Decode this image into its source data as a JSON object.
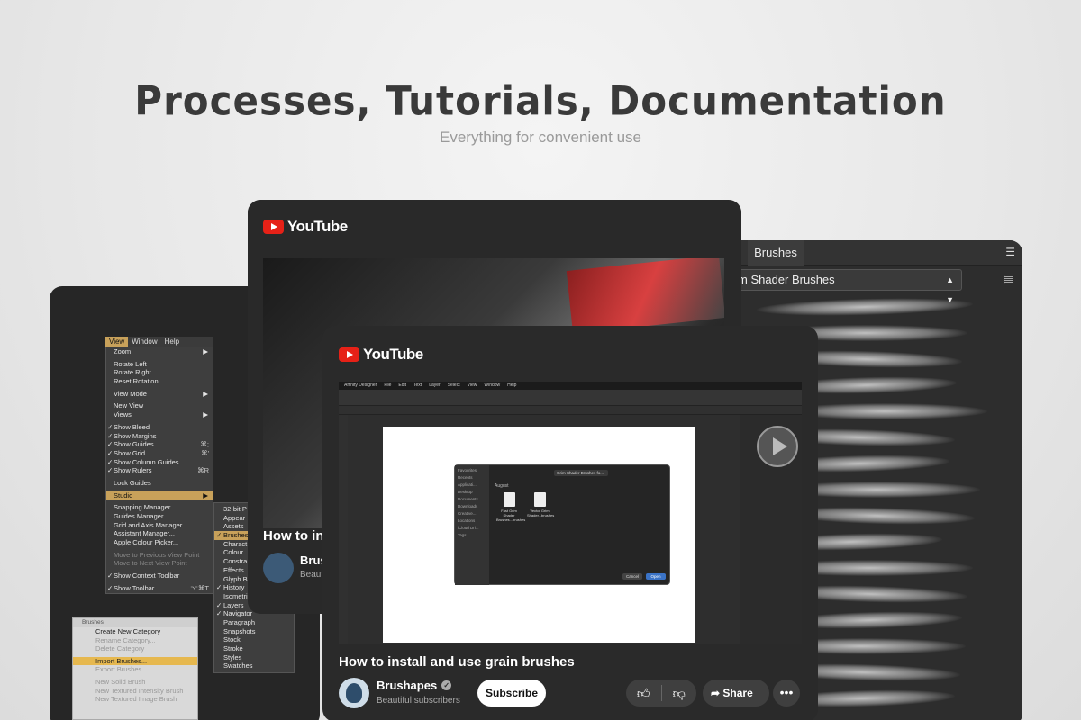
{
  "hero": {
    "title": "Processes, Tutorials, Documentation",
    "subtitle": "Everything for convenient use"
  },
  "left_menu": {
    "menubar": [
      "View",
      "Window",
      "Help"
    ],
    "items": [
      {
        "label": "Zoom",
        "arrow": "▶"
      },
      {
        "label": "Rotate Left",
        "gap": true
      },
      {
        "label": "Rotate Right"
      },
      {
        "label": "Reset Rotation"
      },
      {
        "label": "View Mode",
        "arrow": "▶",
        "gap": true
      },
      {
        "label": "New View",
        "gap": true
      },
      {
        "label": "Views",
        "arrow": "▶"
      },
      {
        "label": "Show Bleed",
        "check": "✓",
        "gap": true
      },
      {
        "label": "Show Margins",
        "check": "✓"
      },
      {
        "label": "Show Guides",
        "check": "✓",
        "shortcut": "⌘;"
      },
      {
        "label": "Show Grid",
        "check": "✓",
        "shortcut": "⌘'"
      },
      {
        "label": "Show Column Guides",
        "check": "✓"
      },
      {
        "label": "Show Rulers",
        "check": "✓",
        "shortcut": "⌘R"
      },
      {
        "label": "Lock Guides",
        "gap": true
      },
      {
        "label": "Studio",
        "arrow": "▶",
        "selected": true,
        "gap": true
      },
      {
        "label": "Snapping Manager...",
        "gap": true
      },
      {
        "label": "Guides Manager..."
      },
      {
        "label": "Grid and Axis Manager..."
      },
      {
        "label": "Assistant Manager..."
      },
      {
        "label": "Apple Colour Picker..."
      },
      {
        "label": "Move to Previous View Point",
        "disabled": true,
        "gap": true
      },
      {
        "label": "Move to Next View Point",
        "disabled": true
      },
      {
        "label": "Show Context Toolbar",
        "check": "✓",
        "gap": true
      },
      {
        "label": "Show Toolbar",
        "check": "✓",
        "shortcut": "⌥⌘T",
        "gap": true
      }
    ],
    "studio_submenu": [
      {
        "label": "32-bit P"
      },
      {
        "label": "Appear"
      },
      {
        "label": "Assets"
      },
      {
        "label": "Brushes",
        "check": "✓",
        "selected": true
      },
      {
        "label": "Charact"
      },
      {
        "label": "Colour"
      },
      {
        "label": "Constra"
      },
      {
        "label": "Effects"
      },
      {
        "label": "Glyph B"
      },
      {
        "label": "History",
        "check": "✓"
      },
      {
        "label": "Isometri"
      },
      {
        "label": "Layers",
        "check": "✓"
      },
      {
        "label": "Navigator",
        "check": "✓"
      },
      {
        "label": "Paragraph"
      },
      {
        "label": "Snapshots"
      },
      {
        "label": "Stock"
      },
      {
        "label": "Stroke"
      },
      {
        "label": "Styles"
      },
      {
        "label": "Swatches"
      }
    ],
    "brushes_menu": {
      "header": "Brushes",
      "items": [
        {
          "label": "Create New Category"
        },
        {
          "label": "Rename Category...",
          "disabled": true
        },
        {
          "label": "Delete Category",
          "disabled": true
        },
        {
          "label": "Import Brushes...",
          "selected": true,
          "gap": true
        },
        {
          "label": "Export Brushes...",
          "disabled": true
        },
        {
          "label": "New Solid Brush",
          "disabled": true,
          "gap": true
        },
        {
          "label": "New Textured Intensity Brush",
          "disabled": true
        },
        {
          "label": "New Textured Image Brush",
          "disabled": true
        }
      ]
    }
  },
  "brushes_panel": {
    "tab": "Brushes",
    "category": "m Shader Brushes",
    "menu_icon": "hamburger-icon",
    "list_icon": "list-icon"
  },
  "yt_back": {
    "logo": "YouTube",
    "title": "How to in",
    "channel": "Brus",
    "subscribers": "Beauti"
  },
  "yt_front": {
    "logo": "YouTube",
    "title": "How to install and use grain brushes",
    "channel": "Brushapes",
    "subscribers": "Beautiful subscribers",
    "subscribe": "Subscribe",
    "share": "Share",
    "like_icon": "thumbs-up-icon",
    "dislike_icon": "thumbs-down-icon",
    "more": "•••",
    "screen": {
      "app_menu": [
        "Affinity Designer",
        "File",
        "Edit",
        "Text",
        "Layer",
        "Select",
        "View",
        "Window",
        "Help"
      ],
      "dialog_sidebar": [
        "Favourites",
        "Recents",
        "Applicati...",
        "Desktop",
        "Documents",
        "Downloads",
        "Creative...",
        "Locations",
        "iCloud Dri...",
        "Tags"
      ],
      "dialog_path": "Grim Shader Brushes fo...",
      "dialog_month": "August",
      "files": [
        "Fast Grim Shader Brushes...brushes",
        "Vector Grim Shader...brushes"
      ],
      "cancel": "Cancel",
      "open": "Open"
    }
  },
  "colors": {
    "accent_menu": "#c8a15a",
    "youtube_red": "#e62117",
    "panel_bg": "#2a2a2a"
  }
}
